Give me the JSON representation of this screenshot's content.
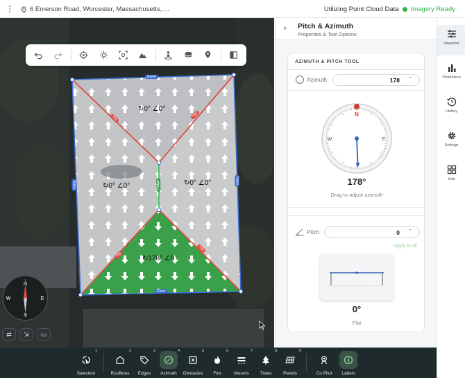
{
  "header": {
    "address": "6 Emerson Road, Worcester, Massachusetts, ...",
    "status_text": "Utilizing Point Cloud Data",
    "imagery_status": "Imagery Ready"
  },
  "map": {
    "face_labels": [
      "↻0° ∠0°",
      "↻0° ∠0°",
      "↻0° ∠0°",
      "↻178° ∠0°"
    ],
    "edge_labels": {
      "eave": "Eave",
      "hip": "Hip",
      "ridge": "Ridge",
      "rake": "Rake"
    },
    "compass": {
      "n": "N",
      "s": "S",
      "e": "E",
      "w": "W"
    }
  },
  "panel": {
    "title": "Pitch & Azimuth",
    "subtitle": "Properties & Tool Options",
    "card_title": "AZIMUTH & PITCH TOOL",
    "azimuth_label": "Azimuth",
    "azimuth_value": "178",
    "azimuth_display": "178°",
    "azimuth_hint": "Drag to adjust azimuth",
    "dial": {
      "n": "N",
      "e": "E",
      "w": "W"
    },
    "pitch_label": "Pitch",
    "pitch_value": "0",
    "apply_label": "Apply to all",
    "pitch_display": "0°",
    "pitch_name": "Flat"
  },
  "rail": [
    {
      "label": "Inspector",
      "icon": "sliders-icon",
      "active": true
    },
    {
      "label": "Production",
      "icon": "bar-chart-icon"
    },
    {
      "label": "History",
      "icon": "history-icon"
    },
    {
      "label": "Settings",
      "icon": "gear-icon"
    },
    {
      "label": "Hub",
      "icon": "grid-icon"
    }
  ],
  "bottom_tools": [
    {
      "label": "Selection",
      "num": "1",
      "icon": "selection-icon"
    },
    {
      "label": "Rooflines",
      "num": "2",
      "icon": "roofline-icon"
    },
    {
      "label": "Edges",
      "num": "3",
      "icon": "tag-icon"
    },
    {
      "label": "Azimuth",
      "num": "4",
      "icon": "compass-icon",
      "active": true
    },
    {
      "label": "Obstacles",
      "num": "5",
      "icon": "obstacle-icon"
    },
    {
      "label": "Fire",
      "num": "6",
      "icon": "fire-icon"
    },
    {
      "label": "Mounts",
      "num": "7",
      "icon": "mount-icon"
    },
    {
      "label": "Trees",
      "num": "8",
      "icon": "tree-icon"
    },
    {
      "label": "Panels",
      "num": "9",
      "icon": "panel-icon"
    },
    {
      "label": "Co Pilot",
      "num": "",
      "icon": "copilot-icon"
    },
    {
      "label": "Labels",
      "num": "",
      "icon": "info-icon",
      "active": true
    }
  ],
  "colors": {
    "accent_green": "#2fb24c",
    "roof_green": "#3aa04a",
    "edge_red": "#e0463c",
    "edge_blue": "#3b6fd4",
    "dark_bar": "#1f2a2d"
  }
}
